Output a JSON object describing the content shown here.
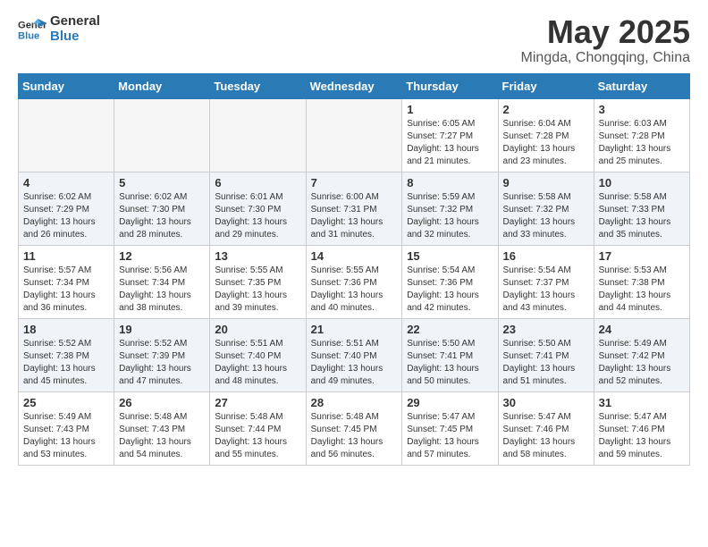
{
  "logo": {
    "line1": "General",
    "line2": "Blue"
  },
  "title": "May 2025",
  "subtitle": "Mingda, Chongqing, China",
  "weekdays": [
    "Sunday",
    "Monday",
    "Tuesday",
    "Wednesday",
    "Thursday",
    "Friday",
    "Saturday"
  ],
  "weeks": [
    [
      {
        "day": "",
        "info": ""
      },
      {
        "day": "",
        "info": ""
      },
      {
        "day": "",
        "info": ""
      },
      {
        "day": "",
        "info": ""
      },
      {
        "day": "1",
        "info": "Sunrise: 6:05 AM\nSunset: 7:27 PM\nDaylight: 13 hours\nand 21 minutes."
      },
      {
        "day": "2",
        "info": "Sunrise: 6:04 AM\nSunset: 7:28 PM\nDaylight: 13 hours\nand 23 minutes."
      },
      {
        "day": "3",
        "info": "Sunrise: 6:03 AM\nSunset: 7:28 PM\nDaylight: 13 hours\nand 25 minutes."
      }
    ],
    [
      {
        "day": "4",
        "info": "Sunrise: 6:02 AM\nSunset: 7:29 PM\nDaylight: 13 hours\nand 26 minutes."
      },
      {
        "day": "5",
        "info": "Sunrise: 6:02 AM\nSunset: 7:30 PM\nDaylight: 13 hours\nand 28 minutes."
      },
      {
        "day": "6",
        "info": "Sunrise: 6:01 AM\nSunset: 7:30 PM\nDaylight: 13 hours\nand 29 minutes."
      },
      {
        "day": "7",
        "info": "Sunrise: 6:00 AM\nSunset: 7:31 PM\nDaylight: 13 hours\nand 31 minutes."
      },
      {
        "day": "8",
        "info": "Sunrise: 5:59 AM\nSunset: 7:32 PM\nDaylight: 13 hours\nand 32 minutes."
      },
      {
        "day": "9",
        "info": "Sunrise: 5:58 AM\nSunset: 7:32 PM\nDaylight: 13 hours\nand 33 minutes."
      },
      {
        "day": "10",
        "info": "Sunrise: 5:58 AM\nSunset: 7:33 PM\nDaylight: 13 hours\nand 35 minutes."
      }
    ],
    [
      {
        "day": "11",
        "info": "Sunrise: 5:57 AM\nSunset: 7:34 PM\nDaylight: 13 hours\nand 36 minutes."
      },
      {
        "day": "12",
        "info": "Sunrise: 5:56 AM\nSunset: 7:34 PM\nDaylight: 13 hours\nand 38 minutes."
      },
      {
        "day": "13",
        "info": "Sunrise: 5:55 AM\nSunset: 7:35 PM\nDaylight: 13 hours\nand 39 minutes."
      },
      {
        "day": "14",
        "info": "Sunrise: 5:55 AM\nSunset: 7:36 PM\nDaylight: 13 hours\nand 40 minutes."
      },
      {
        "day": "15",
        "info": "Sunrise: 5:54 AM\nSunset: 7:36 PM\nDaylight: 13 hours\nand 42 minutes."
      },
      {
        "day": "16",
        "info": "Sunrise: 5:54 AM\nSunset: 7:37 PM\nDaylight: 13 hours\nand 43 minutes."
      },
      {
        "day": "17",
        "info": "Sunrise: 5:53 AM\nSunset: 7:38 PM\nDaylight: 13 hours\nand 44 minutes."
      }
    ],
    [
      {
        "day": "18",
        "info": "Sunrise: 5:52 AM\nSunset: 7:38 PM\nDaylight: 13 hours\nand 45 minutes."
      },
      {
        "day": "19",
        "info": "Sunrise: 5:52 AM\nSunset: 7:39 PM\nDaylight: 13 hours\nand 47 minutes."
      },
      {
        "day": "20",
        "info": "Sunrise: 5:51 AM\nSunset: 7:40 PM\nDaylight: 13 hours\nand 48 minutes."
      },
      {
        "day": "21",
        "info": "Sunrise: 5:51 AM\nSunset: 7:40 PM\nDaylight: 13 hours\nand 49 minutes."
      },
      {
        "day": "22",
        "info": "Sunrise: 5:50 AM\nSunset: 7:41 PM\nDaylight: 13 hours\nand 50 minutes."
      },
      {
        "day": "23",
        "info": "Sunrise: 5:50 AM\nSunset: 7:41 PM\nDaylight: 13 hours\nand 51 minutes."
      },
      {
        "day": "24",
        "info": "Sunrise: 5:49 AM\nSunset: 7:42 PM\nDaylight: 13 hours\nand 52 minutes."
      }
    ],
    [
      {
        "day": "25",
        "info": "Sunrise: 5:49 AM\nSunset: 7:43 PM\nDaylight: 13 hours\nand 53 minutes."
      },
      {
        "day": "26",
        "info": "Sunrise: 5:48 AM\nSunset: 7:43 PM\nDaylight: 13 hours\nand 54 minutes."
      },
      {
        "day": "27",
        "info": "Sunrise: 5:48 AM\nSunset: 7:44 PM\nDaylight: 13 hours\nand 55 minutes."
      },
      {
        "day": "28",
        "info": "Sunrise: 5:48 AM\nSunset: 7:45 PM\nDaylight: 13 hours\nand 56 minutes."
      },
      {
        "day": "29",
        "info": "Sunrise: 5:47 AM\nSunset: 7:45 PM\nDaylight: 13 hours\nand 57 minutes."
      },
      {
        "day": "30",
        "info": "Sunrise: 5:47 AM\nSunset: 7:46 PM\nDaylight: 13 hours\nand 58 minutes."
      },
      {
        "day": "31",
        "info": "Sunrise: 5:47 AM\nSunset: 7:46 PM\nDaylight: 13 hours\nand 59 minutes."
      }
    ]
  ]
}
